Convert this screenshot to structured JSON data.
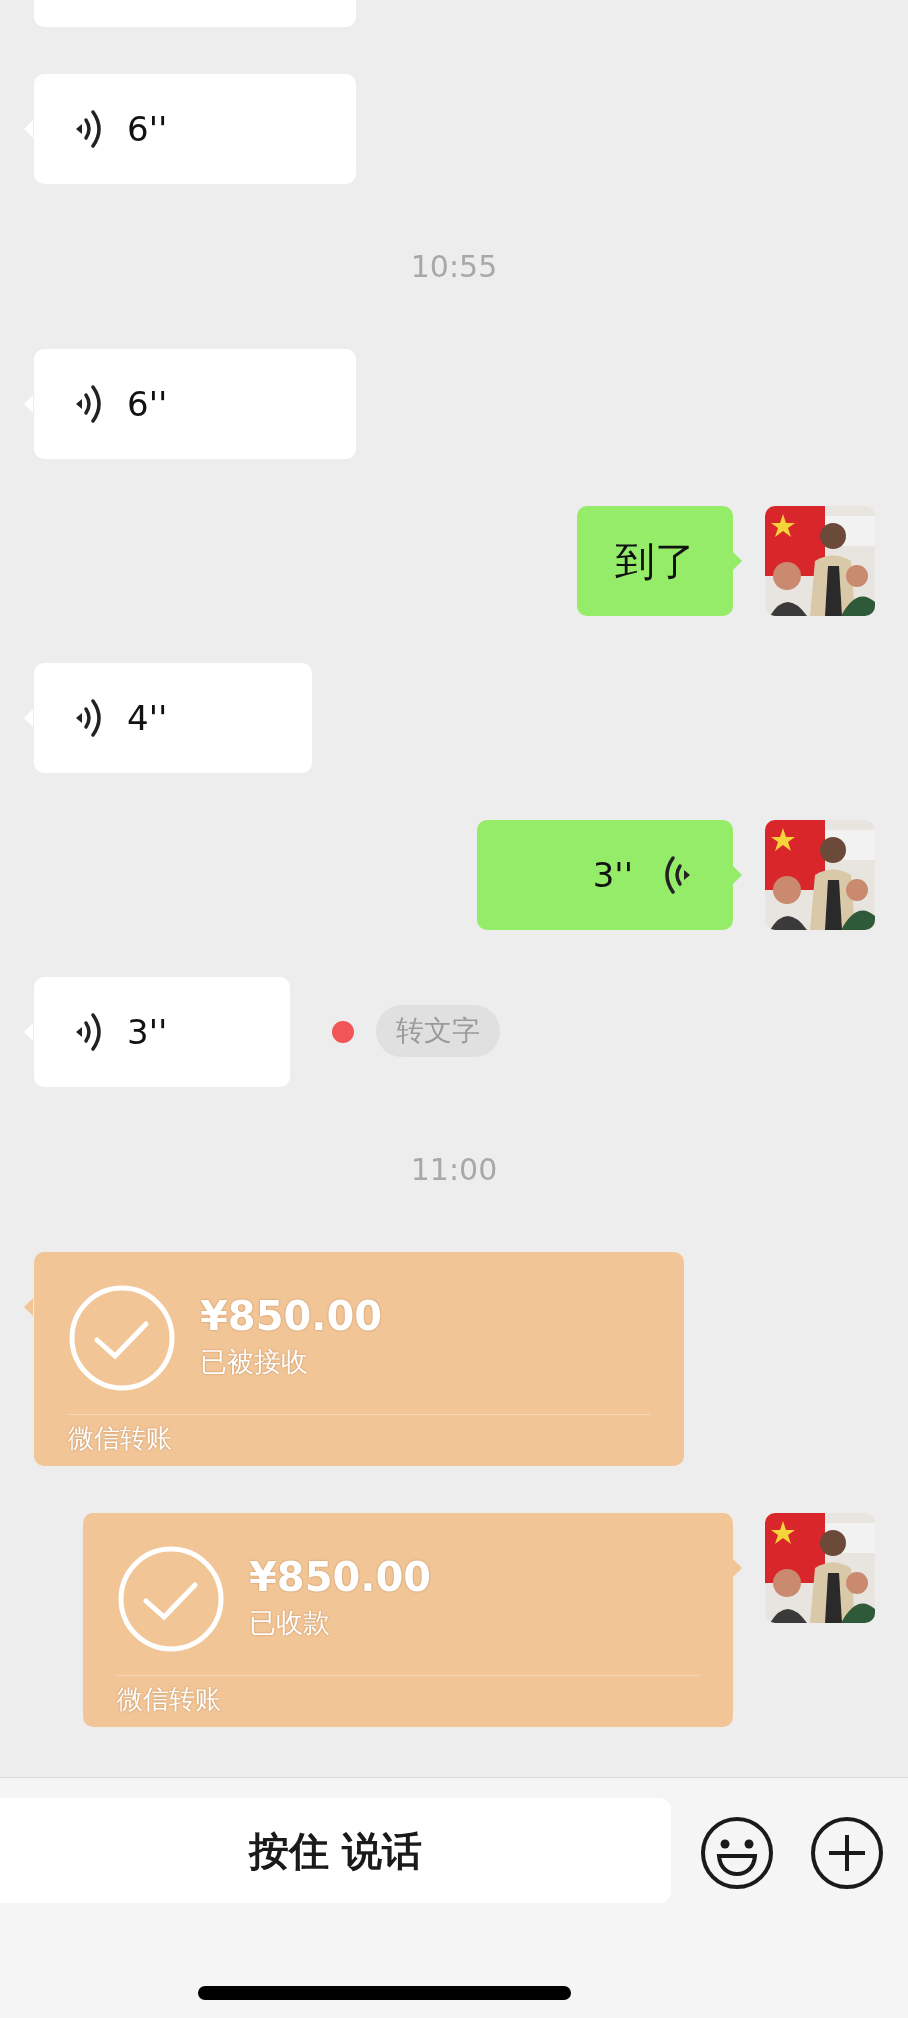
{
  "messages": [
    {
      "kind": "cut_off",
      "outgoing": false
    },
    {
      "kind": "voice",
      "outgoing": false,
      "duration": "6''",
      "unread": false
    },
    {
      "kind": "time",
      "text": "10:55"
    },
    {
      "kind": "voice",
      "outgoing": false,
      "duration": "6''",
      "unread": false
    },
    {
      "kind": "text",
      "outgoing": true,
      "text": "到了"
    },
    {
      "kind": "voice",
      "outgoing": false,
      "duration": "4''",
      "unread": false
    },
    {
      "kind": "voice",
      "outgoing": true,
      "duration": "3''",
      "unread": false
    },
    {
      "kind": "voice",
      "outgoing": false,
      "duration": "3''",
      "unread": true,
      "action": "转文字"
    },
    {
      "kind": "time",
      "text": "11:00"
    },
    {
      "kind": "transfer",
      "outgoing": false,
      "amount": "¥850.00",
      "status": "已被接收",
      "footer": "微信转账"
    },
    {
      "kind": "transfer",
      "outgoing": true,
      "amount": "¥850.00",
      "status": "已收款",
      "footer": "微信转账"
    }
  ],
  "input_bar": {
    "hold_to_talk": "按住 说话"
  }
}
